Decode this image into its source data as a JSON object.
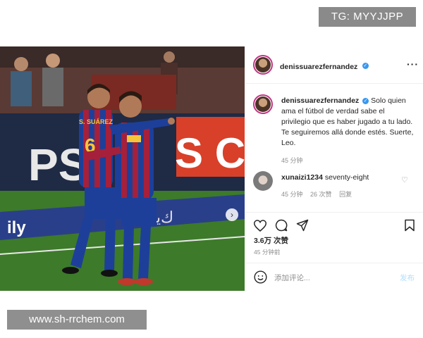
{
  "watermarks": {
    "top": "TG: MYYJJPP",
    "bottom": "www.sh-rrchem.com"
  },
  "post": {
    "author": "denissuarezfernandez",
    "caption_author": "denissuarezfernandez",
    "caption_text": "Solo quien ama el fútbol de verdad sabe el privilegio que es haber jugado a tu lado. Te seguiremos allá donde estés. Suerte, Leo.",
    "caption_time": "45 分钟",
    "likes": "3.6万 次赞",
    "posted_ago": "45 分钟前"
  },
  "comment": {
    "user": "xunaizi1234",
    "text": "seventy-eight",
    "time": "45 分钟",
    "likes": "26 次赞",
    "reply": "回复"
  },
  "photo": {
    "jersey_name": "S. SUÁREZ",
    "jersey_number": "6",
    "board_text": "S CU",
    "board_text_left": "PS",
    "ad_text": "ily"
  },
  "comment_bar": {
    "placeholder": "添加评论...",
    "post_label": "发布"
  },
  "icons": {
    "more": "more-dots-icon",
    "next": "chevron-right-icon",
    "tag": "person-tag-icon",
    "like": "heart-icon",
    "comment": "comment-icon",
    "share": "send-icon",
    "save": "bookmark-icon",
    "emoji": "emoji-icon"
  },
  "colors": {
    "verified": "#3897f0",
    "story_ring": "#c13584",
    "post_disabled": "#b2dffc"
  }
}
